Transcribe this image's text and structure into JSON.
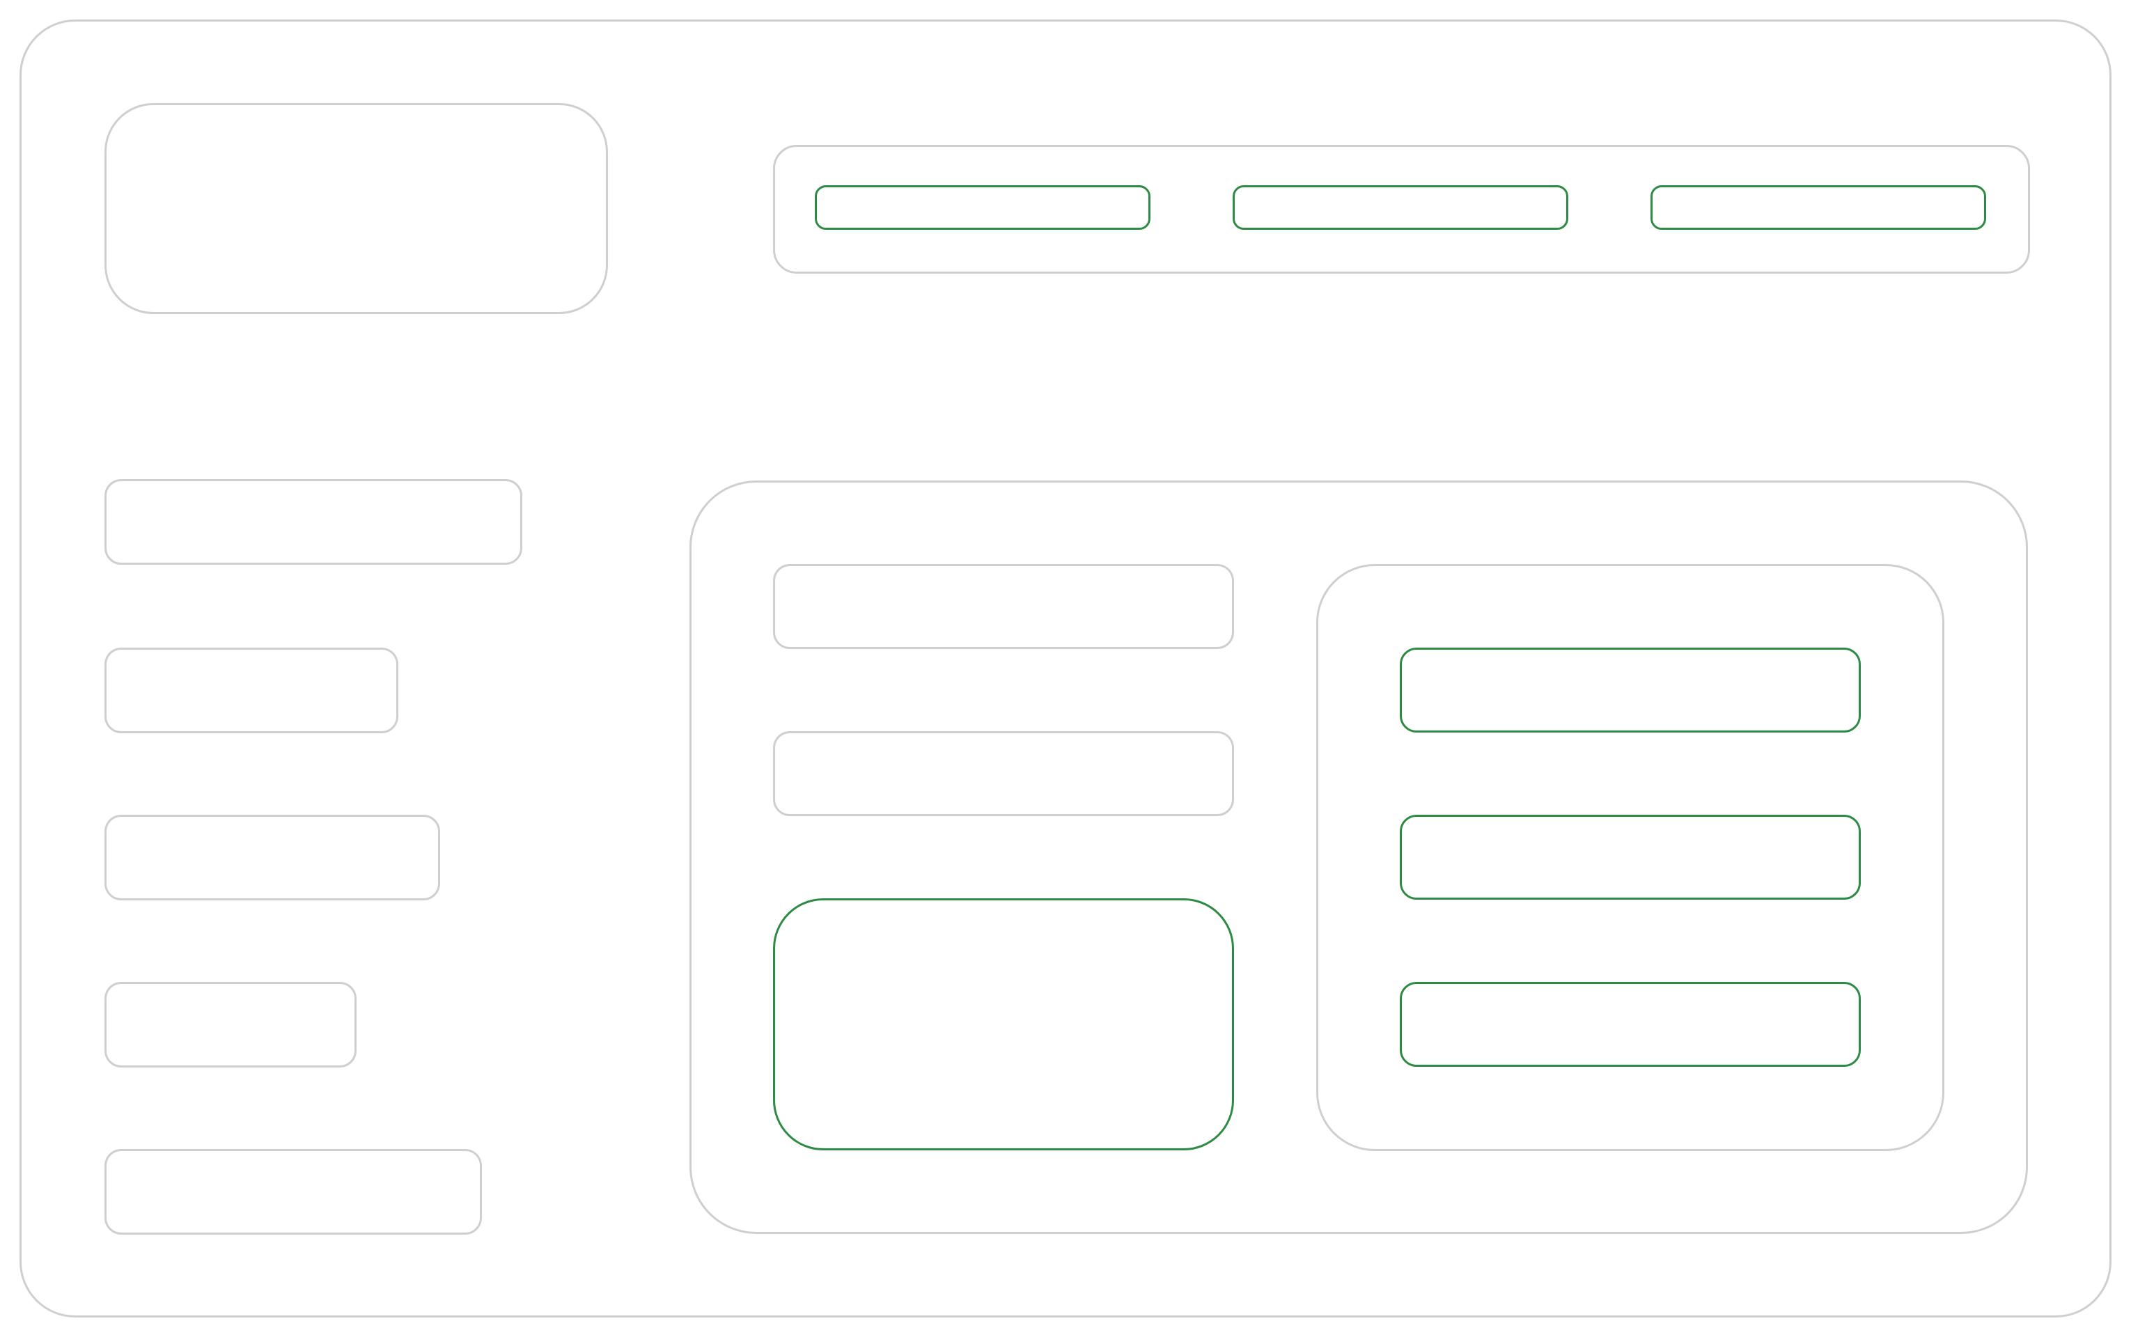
{
  "colors": {
    "frame": "#cfcfcf",
    "interactive": "#2e8b43",
    "background": "#ffffff"
  },
  "header": {
    "nav_items": [
      "",
      "",
      ""
    ]
  },
  "sidebar": {
    "items": [
      "",
      "",
      "",
      "",
      ""
    ]
  },
  "main": {
    "rows": [
      "",
      ""
    ],
    "card": ""
  },
  "right_panel": {
    "buttons": [
      "",
      "",
      ""
    ]
  }
}
